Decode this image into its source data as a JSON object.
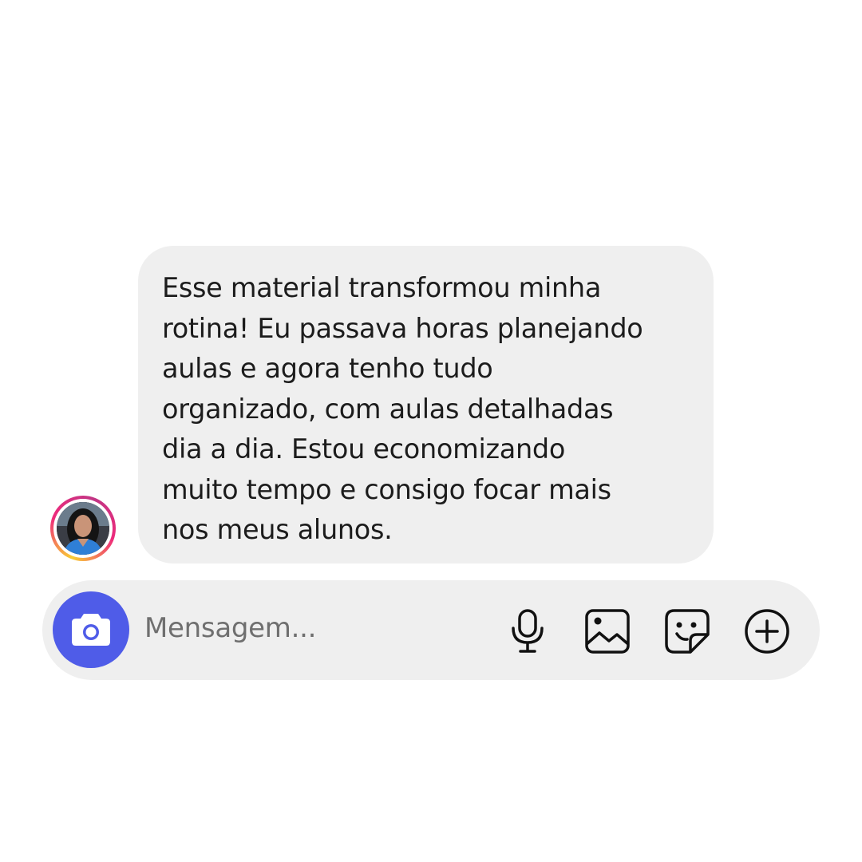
{
  "message": {
    "lines": [
      "Esse material transformou minha",
      "rotina! Eu passava horas planejando",
      "aulas e agora tenho tudo",
      "organizado, com aulas detalhadas",
      "dia a dia. Estou economizando",
      "muito tempo e consigo focar mais",
      "nos meus alunos."
    ]
  },
  "composer": {
    "placeholder": "Mensagem..."
  },
  "icons": {
    "camera": "camera-icon",
    "microphone": "microphone-icon",
    "gallery": "image-gallery-icon",
    "sticker": "sticker-icon",
    "add": "plus-circle-icon"
  },
  "colors": {
    "bubble": "#efefef",
    "camera_button": "#4f5ce8",
    "text": "#1c1c1c",
    "placeholder": "#6f6f6f"
  }
}
